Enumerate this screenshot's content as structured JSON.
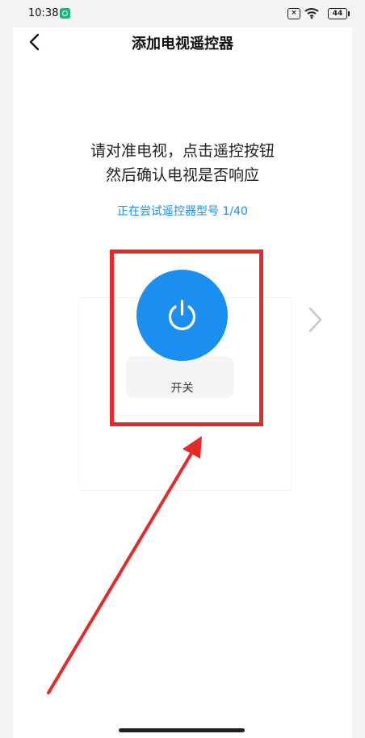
{
  "status_bar": {
    "time": "10:38",
    "battery": "44",
    "sim_indicator": "×",
    "icons": [
      "app-notification-icon",
      "no-sim-icon",
      "wifi-icon",
      "battery-icon"
    ]
  },
  "header": {
    "back_icon": "chevron-left-icon",
    "title": "添加电视遥控器"
  },
  "instruction": {
    "line1": "请对准电视，点击遥控按钮",
    "line2": "然后确认电视是否响应"
  },
  "model_info": "正在尝试遥控器型号 1/40",
  "remote": {
    "power_icon": "power-icon",
    "power_label": "开关",
    "power_color": "#1b8ff0",
    "next_icon": "chevron-right-icon"
  },
  "annotation": {
    "color": "#e52a2a"
  }
}
